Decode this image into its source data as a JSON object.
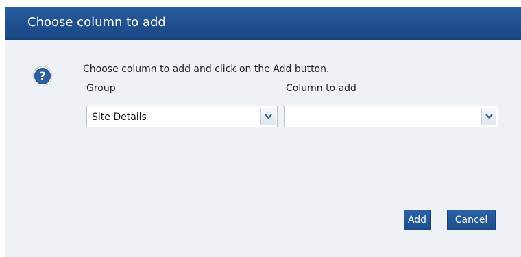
{
  "dialog": {
    "title": "Choose column to add",
    "instruction": "Choose column to add and click on the Add button.",
    "help_icon": "question-mark-icon",
    "group": {
      "label": "Group",
      "value": "Site Details",
      "arrow_icon": "chevron-down-icon"
    },
    "column": {
      "label": "Column to add",
      "value": "",
      "arrow_icon": "chevron-down-icon"
    },
    "buttons": {
      "add_label": "Add",
      "cancel_label": "Cancel"
    }
  },
  "colors": {
    "title_bar": "#1f4f8e",
    "dialog_background": "#eef2f7",
    "button": "#1b4d8c",
    "icon": "#2b5f9e"
  }
}
